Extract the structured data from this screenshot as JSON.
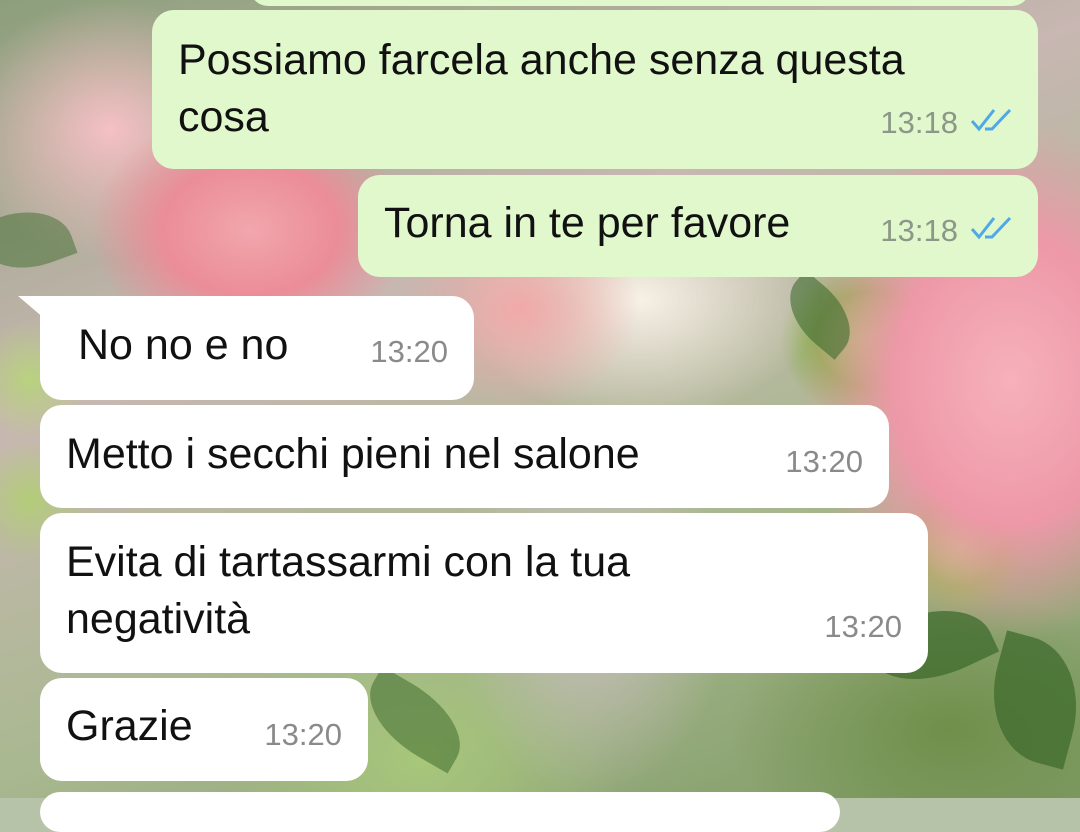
{
  "colors": {
    "outgoing_bubble": "#e1f8cc",
    "incoming_bubble": "#ffffff",
    "read_ticks": "#4fa9e8",
    "timestamp": "#8b9788"
  },
  "messages": [
    {
      "direction": "outgoing",
      "lines": [
        "Possiamo farcela anche senza questa",
        "cosa"
      ],
      "time": "13:18",
      "status_icon": "double-check-read-icon"
    },
    {
      "direction": "outgoing",
      "lines": [
        "Torna in te per favore"
      ],
      "time": "13:18",
      "status_icon": "double-check-read-icon"
    },
    {
      "direction": "incoming",
      "lines": [
        "No no e no"
      ],
      "time": "13:20"
    },
    {
      "direction": "incoming",
      "lines": [
        "Metto i secchi pieni nel salone"
      ],
      "time": "13:20"
    },
    {
      "direction": "incoming",
      "lines": [
        "Evita di tartassarmi con la tua",
        "negatività"
      ],
      "time": "13:20"
    },
    {
      "direction": "incoming",
      "lines": [
        "Grazie"
      ],
      "time": "13:20"
    }
  ]
}
